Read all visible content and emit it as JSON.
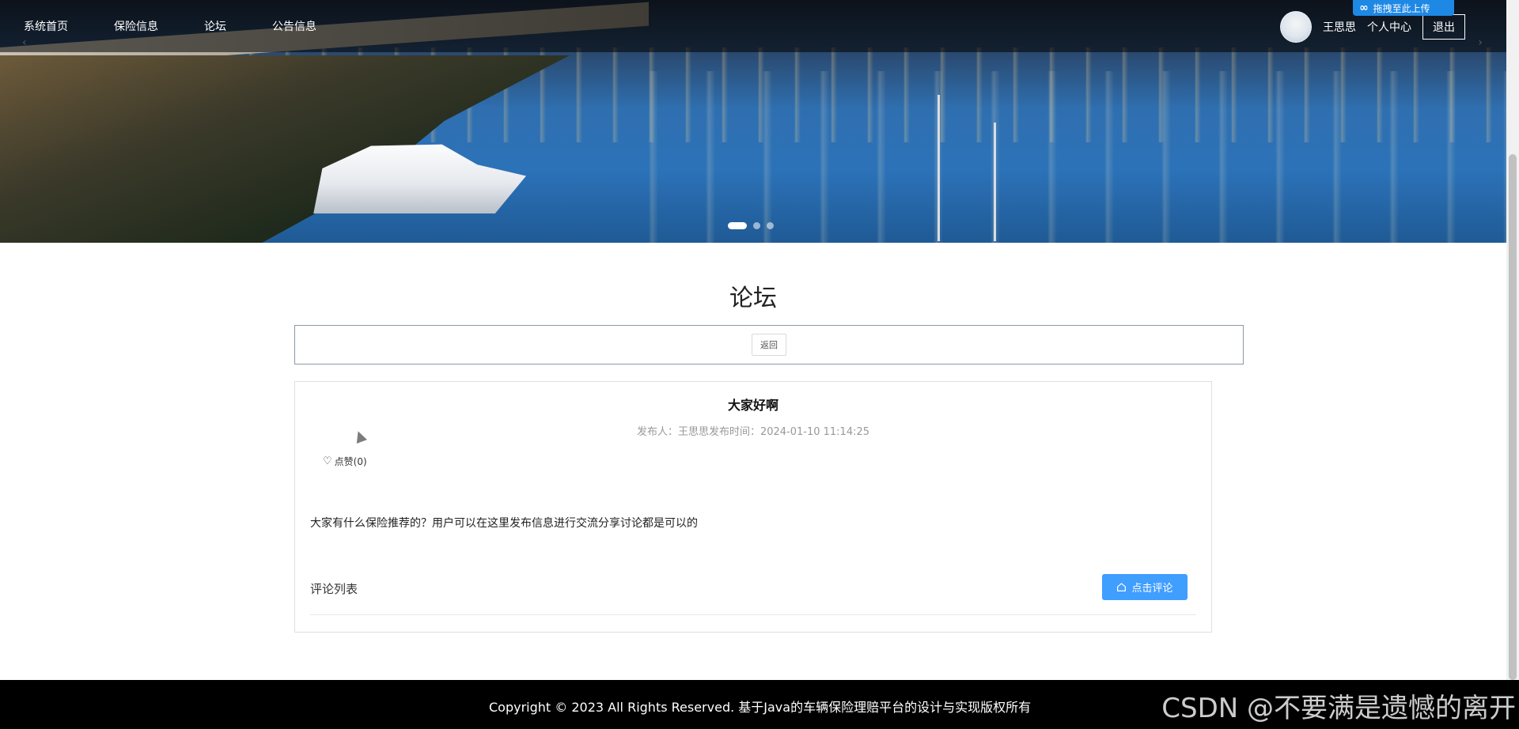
{
  "nav": {
    "items": [
      "系统首页",
      "保险信息",
      "论坛",
      "公告信息"
    ]
  },
  "user": {
    "name": "王思思",
    "center_label": "个人中心",
    "logout_label": "退出"
  },
  "upload_badge": {
    "icon": "infinity-icon",
    "label": "拖拽至此上传"
  },
  "carousel": {
    "prev_glyph": "‹",
    "next_glyph": "›",
    "slides": 3,
    "active_index": 0
  },
  "page": {
    "title": "论坛",
    "back_label": "返回"
  },
  "post": {
    "title": "大家好啊",
    "meta": "发布人：王思思发布时间：2024-01-10 11:14:25",
    "like_label": "点赞(0)",
    "body": "大家有什么保险推荐的？用户可以在这里发布信息进行交流分享讨论都是可以的",
    "comment_list_label": "评论列表",
    "comment_button_label": "点击评论"
  },
  "footer": {
    "copyright": "Copyright © 2023 All Rights Reserved. 基于Java的车辆保险理赔平台的设计与实现版权所有",
    "watermark": "CSDN @不要满是遗憾的离开"
  },
  "colors": {
    "primary_button": "#409eff",
    "footer_bg": "#000000",
    "upload_badge": "#1e88e5"
  }
}
